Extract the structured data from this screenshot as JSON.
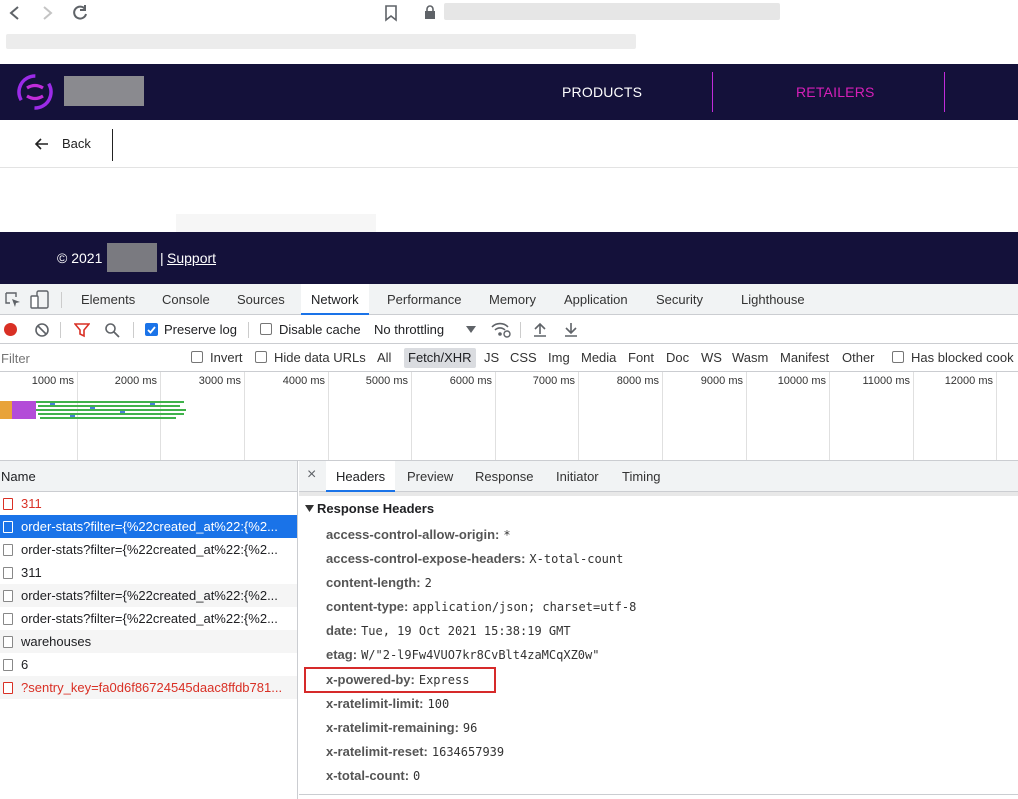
{
  "site": {
    "nav_products": "PRODUCTS",
    "nav_retailers": "RETAILERS",
    "back_label": "Back",
    "footer_copyright": "© 2021",
    "footer_support": "Support"
  },
  "colors": {
    "brand_dark": "#14113a",
    "accent": "#d61fb8",
    "devtools_blue": "#1a73e8",
    "error_red": "#d93025"
  },
  "devtools": {
    "tabs": [
      "Elements",
      "Console",
      "Sources",
      "Network",
      "Performance",
      "Memory",
      "Application",
      "Security",
      "Lighthouse"
    ],
    "active_tab": "Network",
    "toolbar": {
      "preserve_log": "Preserve log",
      "disable_cache": "Disable cache",
      "throttling": "No throttling"
    },
    "filter": {
      "placeholder": "Filter",
      "invert": "Invert",
      "hide_data_urls": "Hide data URLs",
      "types": [
        "All",
        "Fetch/XHR",
        "JS",
        "CSS",
        "Img",
        "Media",
        "Font",
        "Doc",
        "WS",
        "Wasm",
        "Manifest",
        "Other"
      ],
      "active_type": "Fetch/XHR",
      "has_blocked": "Has blocked cook"
    },
    "timeline_ticks": [
      "1000 ms",
      "2000 ms",
      "3000 ms",
      "4000 ms",
      "5000 ms",
      "6000 ms",
      "7000 ms",
      "8000 ms",
      "9000 ms",
      "10000 ms",
      "11000 ms",
      "12000 ms"
    ],
    "name_header": "Name",
    "requests": [
      {
        "name": "311",
        "error": true
      },
      {
        "name": "order-stats?filter={%22created_at%22:{%2...",
        "selected": true
      },
      {
        "name": "order-stats?filter={%22created_at%22:{%2..."
      },
      {
        "name": "311"
      },
      {
        "name": "order-stats?filter={%22created_at%22:{%2..."
      },
      {
        "name": "order-stats?filter={%22created_at%22:{%2..."
      },
      {
        "name": "warehouses"
      },
      {
        "name": "6"
      },
      {
        "name": "?sentry_key=fa0d6f86724545daac8ffdb781...",
        "error": true
      }
    ],
    "detail_close": "×",
    "detail_tabs": [
      "Headers",
      "Preview",
      "Response",
      "Initiator",
      "Timing"
    ],
    "active_detail_tab": "Headers",
    "section_title": "Response Headers",
    "headers": [
      {
        "key": "access-control-allow-origin:",
        "value": "*"
      },
      {
        "key": "access-control-expose-headers:",
        "value": "X-total-count"
      },
      {
        "key": "content-length:",
        "value": "2"
      },
      {
        "key": "content-type:",
        "value": "application/json; charset=utf-8"
      },
      {
        "key": "date:",
        "value": "Tue, 19 Oct 2021 15:38:19 GMT"
      },
      {
        "key": "etag:",
        "value": "W/\"2-l9Fw4VUO7kr8CvBlt4zaMCqXZ0w\""
      },
      {
        "key": "x-powered-by:",
        "value": "Express",
        "highlighted": true
      },
      {
        "key": "x-ratelimit-limit:",
        "value": "100"
      },
      {
        "key": "x-ratelimit-remaining:",
        "value": "96"
      },
      {
        "key": "x-ratelimit-reset:",
        "value": "1634657939"
      },
      {
        "key": "x-total-count:",
        "value": "0"
      }
    ]
  }
}
